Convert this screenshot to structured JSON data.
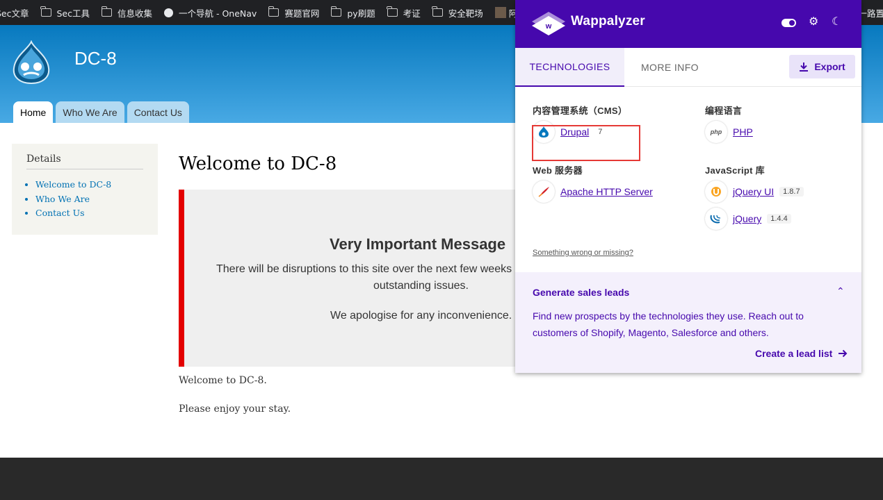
{
  "bookmarks": [
    {
      "icon": "text-icon",
      "label": "Sec文章"
    },
    {
      "icon": "folder-icon",
      "label": "Sec工具"
    },
    {
      "icon": "folder-icon",
      "label": "信息收集"
    },
    {
      "icon": "compass-icon",
      "label": "一个导航 - OneNav"
    },
    {
      "icon": "folder-icon",
      "label": "赛题官网"
    },
    {
      "icon": "folder-icon",
      "label": "py刷题"
    },
    {
      "icon": "folder-icon",
      "label": "考证"
    },
    {
      "icon": "folder-icon",
      "label": "安全靶场"
    },
    {
      "icon": "photo-icon",
      "label": "阿"
    }
  ],
  "bookmarks_right": "一路置",
  "site": {
    "name": "DC-8",
    "tabs": [
      "Home",
      "Who We Are",
      "Contact Us"
    ]
  },
  "sidebar": {
    "title": "Details",
    "links": [
      "Welcome to DC-8",
      "Who We Are",
      "Contact Us"
    ]
  },
  "main": {
    "title": "Welcome to DC-8",
    "message_title": "Very Important Message",
    "message_line1": "There will be disruptions to this site over the next few weeks",
    "message_line2": "outstanding issues.",
    "message_line3": "We apologise for any inconvenience.",
    "para1": "Welcome to DC-8.",
    "para2": "Please enjoy your stay."
  },
  "wappalyzer": {
    "brand": "Wappalyzer",
    "tabs": {
      "technologies": "TECHNOLOGIES",
      "more_info": "MORE INFO"
    },
    "export_label": "Export",
    "categories": {
      "cms": {
        "label": "内容管理系统（CMS）",
        "tech": {
          "name": "Drupal",
          "version": "7",
          "icon": "drupal-icon"
        }
      },
      "lang": {
        "label": "编程语言",
        "tech": {
          "name": "PHP",
          "icon": "php-icon"
        }
      },
      "web": {
        "label": "Web 服务器",
        "tech": {
          "name": "Apache HTTP Server",
          "icon": "apache-icon"
        }
      },
      "js": {
        "label": "JavaScript 库",
        "techs": [
          {
            "name": "jQuery UI",
            "version": "1.8.7",
            "icon": "jquery-ui-icon"
          },
          {
            "name": "jQuery",
            "version": "1.4.4",
            "icon": "jquery-icon"
          }
        ]
      }
    },
    "wrong_link": "Something wrong or missing?",
    "leads": {
      "title": "Generate sales leads",
      "text": "Find new prospects by the technologies they use. Reach out to customers of Shopify, Magento, Salesforce and others.",
      "cta": "Create a lead list"
    },
    "accent": "#4608ad"
  },
  "colors": {
    "header_blue": "#0779bf",
    "message_border": "#e30000",
    "highlight_box": "#e53935",
    "footer": "#292929"
  }
}
